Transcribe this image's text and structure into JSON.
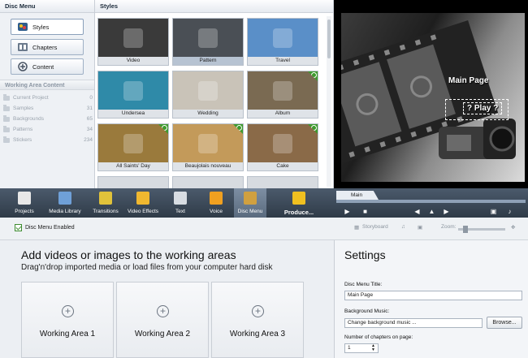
{
  "left_panel": {
    "title": "Disc Menu",
    "buttons": [
      {
        "label": "Styles",
        "icon": "palette-icon"
      },
      {
        "label": "Chapters",
        "icon": "chapters-icon"
      },
      {
        "label": "Content",
        "icon": "content-icon"
      }
    ],
    "working_area_header": "Working Area Content",
    "folders": [
      {
        "name": "Current Project",
        "count": "0"
      },
      {
        "name": "Samples",
        "count": "31"
      },
      {
        "name": "Backgrounds",
        "count": "65"
      },
      {
        "name": "Patterns",
        "count": "34"
      },
      {
        "name": "Stickers",
        "count": "234"
      }
    ]
  },
  "styles_panel": {
    "title": "Styles",
    "thumbnails": [
      {
        "label": "Video",
        "bg": "#3a3a3a",
        "badge": false
      },
      {
        "label": "Pattern",
        "bg": "#4a4f55",
        "badge": false
      },
      {
        "label": "Travel",
        "bg": "#5a8fc8",
        "badge": false
      },
      {
        "label": "Undersea",
        "bg": "#2f8aa8",
        "badge": false
      },
      {
        "label": "Wedding",
        "bg": "#c9c3b8",
        "badge": false
      },
      {
        "label": "Album",
        "bg": "#7a6a52",
        "badge": true
      },
      {
        "label": "All Saints' Day",
        "bg": "#9a7a3c",
        "badge": true
      },
      {
        "label": "Beaujolais nouveau",
        "bg": "#c39a5a",
        "badge": true
      },
      {
        "label": "Cake",
        "bg": "#8a6a48",
        "badge": true
      }
    ]
  },
  "preview": {
    "menu_title": "Main Page",
    "play_label": "? Play ?"
  },
  "toolbar": {
    "items": [
      {
        "label": "Projects",
        "icon": "clapperboard-icon",
        "color": "#e8e8e8"
      },
      {
        "label": "Media Library",
        "icon": "film-strip-icon",
        "color": "#6fa0d8"
      },
      {
        "label": "Transitions",
        "icon": "transitions-icon",
        "color": "#e0c23a"
      },
      {
        "label": "Video Effects",
        "icon": "video-effects-icon",
        "color": "#f0b830"
      },
      {
        "label": "Text",
        "icon": "text-icon",
        "color": "#d8dde3"
      },
      {
        "label": "Voice",
        "icon": "microphone-icon",
        "color": "#f0a020"
      },
      {
        "label": "Disc Menu",
        "icon": "disc-menu-icon",
        "color": "#d0a040"
      },
      {
        "label": "Produce...",
        "icon": "produce-icon",
        "color": "#f0c020"
      }
    ]
  },
  "player": {
    "timeline_tab": "Main"
  },
  "statusbar": {
    "disc_menu_enabled": "Disc Menu Enabled",
    "storyboard": "Storyboard",
    "zoom": "Zoom:"
  },
  "working_area": {
    "title": "Add videos or images to the working areas",
    "subtitle": "Drag'n'drop imported media or load files from your computer hard disk",
    "areas": [
      "Working Area 1",
      "Working Area 2",
      "Working Area 3"
    ]
  },
  "settings": {
    "title": "Settings",
    "disc_menu_title_label": "Disc Menu Title:",
    "disc_menu_title_value": "Main Page",
    "background_music_label": "Background Music:",
    "background_music_value": "Change background music ...",
    "browse_label": "Browse...",
    "chapters_label": "Number of chapters on page:",
    "chapters_value": "1"
  },
  "colors": {
    "toolbar_bg": "#3a4756",
    "accent_green": "#3d9a2d"
  }
}
